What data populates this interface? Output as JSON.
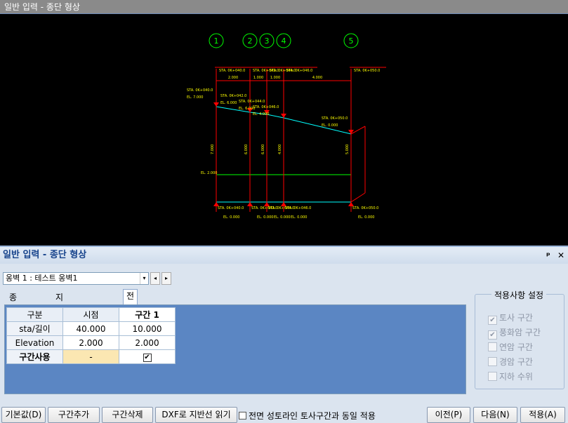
{
  "window": {
    "title": "일반 입력 - 종단 형상"
  },
  "panel": {
    "title": "일반 입력 - 종단 형상",
    "pin": "ᵖ",
    "close": "✕"
  },
  "selector": {
    "value": "옹벽 1 : 테스트 옹벽1",
    "prev": "◂",
    "next": "▸",
    "dropdown": "▾"
  },
  "tabs": [
    {
      "label": "종단 형상"
    },
    {
      "label": "지반선/암선 정보"
    },
    {
      "label": "전면 토사"
    }
  ],
  "grid": {
    "headers": [
      "구분",
      "시점",
      "구간 1"
    ],
    "rows": [
      {
        "label": "sta/길이",
        "start": "40.000",
        "seg1": "10.000"
      },
      {
        "label": "Elevation",
        "start": "2.000",
        "seg1": "2.000"
      },
      {
        "label": "구간사용",
        "start": "-",
        "seg1": "✔"
      }
    ]
  },
  "settings": {
    "title": "적용사항 설정",
    "items": [
      {
        "label": "토사 구간",
        "checked": "✔"
      },
      {
        "label": "풍화암 구간",
        "checked": "✔"
      },
      {
        "label": "연암 구간",
        "checked": ""
      },
      {
        "label": "경암 구간",
        "checked": ""
      },
      {
        "label": "지하 수위",
        "checked": ""
      }
    ]
  },
  "buttons": {
    "default": "기본값(D)",
    "add": "구간추가",
    "delete": "구간삭제",
    "dxf": "DXF로 지반선 읽기",
    "prev": "이전(P)",
    "next": "다음(N)",
    "apply": "적용(A)"
  },
  "same_apply": {
    "label": "전면 성토라인 토사구간과 동일 적용"
  },
  "drawing": {
    "markers": [
      "1",
      "2",
      "3",
      "4",
      "5"
    ],
    "sta_labels": [
      "STA. 0K+040.0",
      "STA. 0K+042.0",
      "STA. 0K+044.0",
      "STA. 0K+046.0",
      "STA. 0K+050.0"
    ],
    "el_labels": [
      "EL. 7.000",
      "EL. 6.000",
      "EL. 6.000",
      "EL. 4.000",
      "EL. 0.000"
    ],
    "dims": [
      "2.000",
      "1.000",
      "1.000",
      "4.000"
    ],
    "heights": [
      "7.000",
      "6.000",
      "6.000",
      "4.000",
      "5.000"
    ],
    "mid_label": "EL. 2.000",
    "colors": {
      "line": "#ff0000",
      "text": "#ffff00",
      "ground": "#00ffff",
      "level": "#00ff00",
      "marker": "#00ff00"
    }
  }
}
